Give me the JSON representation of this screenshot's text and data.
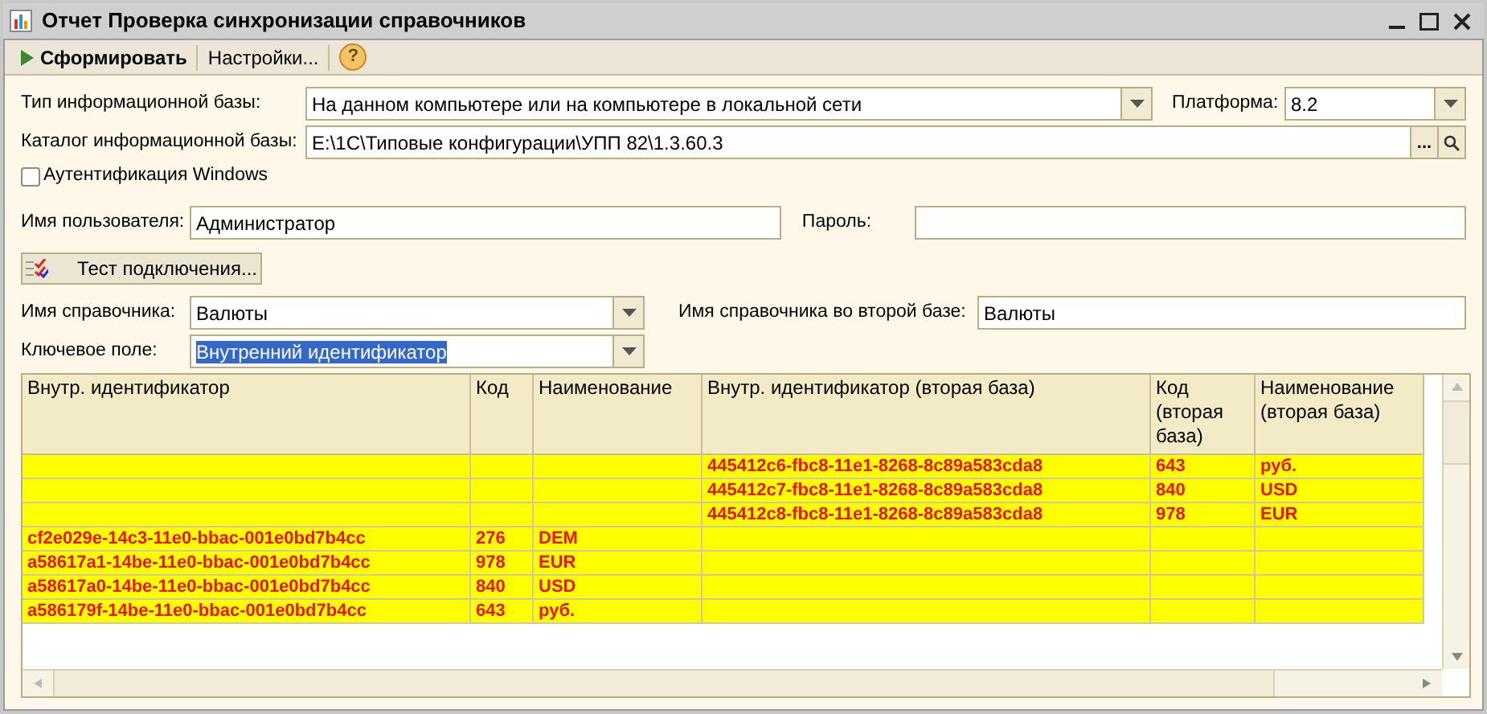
{
  "window": {
    "title": "Отчет  Проверка синхронизации справочников"
  },
  "toolbar": [
    {
      "kind": "run",
      "label": "Сформировать"
    },
    {
      "kind": "plain",
      "label": "Настройки..."
    },
    {
      "kind": "help",
      "label": "?"
    }
  ],
  "form": {
    "db_type": {
      "label": "Тип информационной базы:",
      "value": "На данном компьютере или на компьютере в локальной сети"
    },
    "platform": {
      "label": "Платформа:",
      "value": "8.2"
    },
    "db_path": {
      "label": "Каталог информационной базы:",
      "value": "E:\\1C\\Типовые конфигурации\\УПП 82\\1.3.60.3",
      "button": "..."
    },
    "windows_auth": {
      "label": "Аутентификация Windows",
      "checked": false
    },
    "user": {
      "label": "Имя пользователя:",
      "value": "Администратор"
    },
    "password": {
      "label": "Пароль:"
    },
    "test_button": {
      "label": "Тест подключения..."
    },
    "catalog": {
      "label": "Имя справочника:",
      "value": "Валюты"
    },
    "catalog_second": {
      "label": "Имя справочника во второй базе:",
      "value": "Валюты"
    },
    "key_field": {
      "label": "Ключевое поле:",
      "value": "Внутренний идентификатор",
      "text_selected": true
    }
  },
  "table": {
    "columns": [
      "Внутр. идентификатор",
      "Код",
      "Наименование",
      "Внутр. идентификатор (вторая база)",
      "Код (вторая база)",
      "Наименование (вторая база)"
    ],
    "rows": [
      {
        "id2": "445412c6-fbc8-11e1-8268-8c89a583cda8",
        "code2": "643",
        "name2": "руб."
      },
      {
        "id2": "445412c7-fbc8-11e1-8268-8c89a583cda8",
        "code2": "840",
        "name2": "USD"
      },
      {
        "id2": "445412c8-fbc8-11e1-8268-8c89a583cda8",
        "code2": "978",
        "name2": "EUR"
      },
      {
        "id": "cf2e029e-14c3-11e0-bbac-001e0bd7b4cc",
        "code": "276",
        "name": "DEM"
      },
      {
        "id": "a58617a1-14be-11e0-bbac-001e0bd7b4cc",
        "code": "978",
        "name": "EUR"
      },
      {
        "id": "a58617a0-14be-11e0-bbac-001e0bd7b4cc",
        "code": "840",
        "name": "USD"
      },
      {
        "id": "a586179f-14be-11e0-bbac-001e0bd7b4cc",
        "code": "643",
        "name": "руб."
      }
    ]
  }
}
